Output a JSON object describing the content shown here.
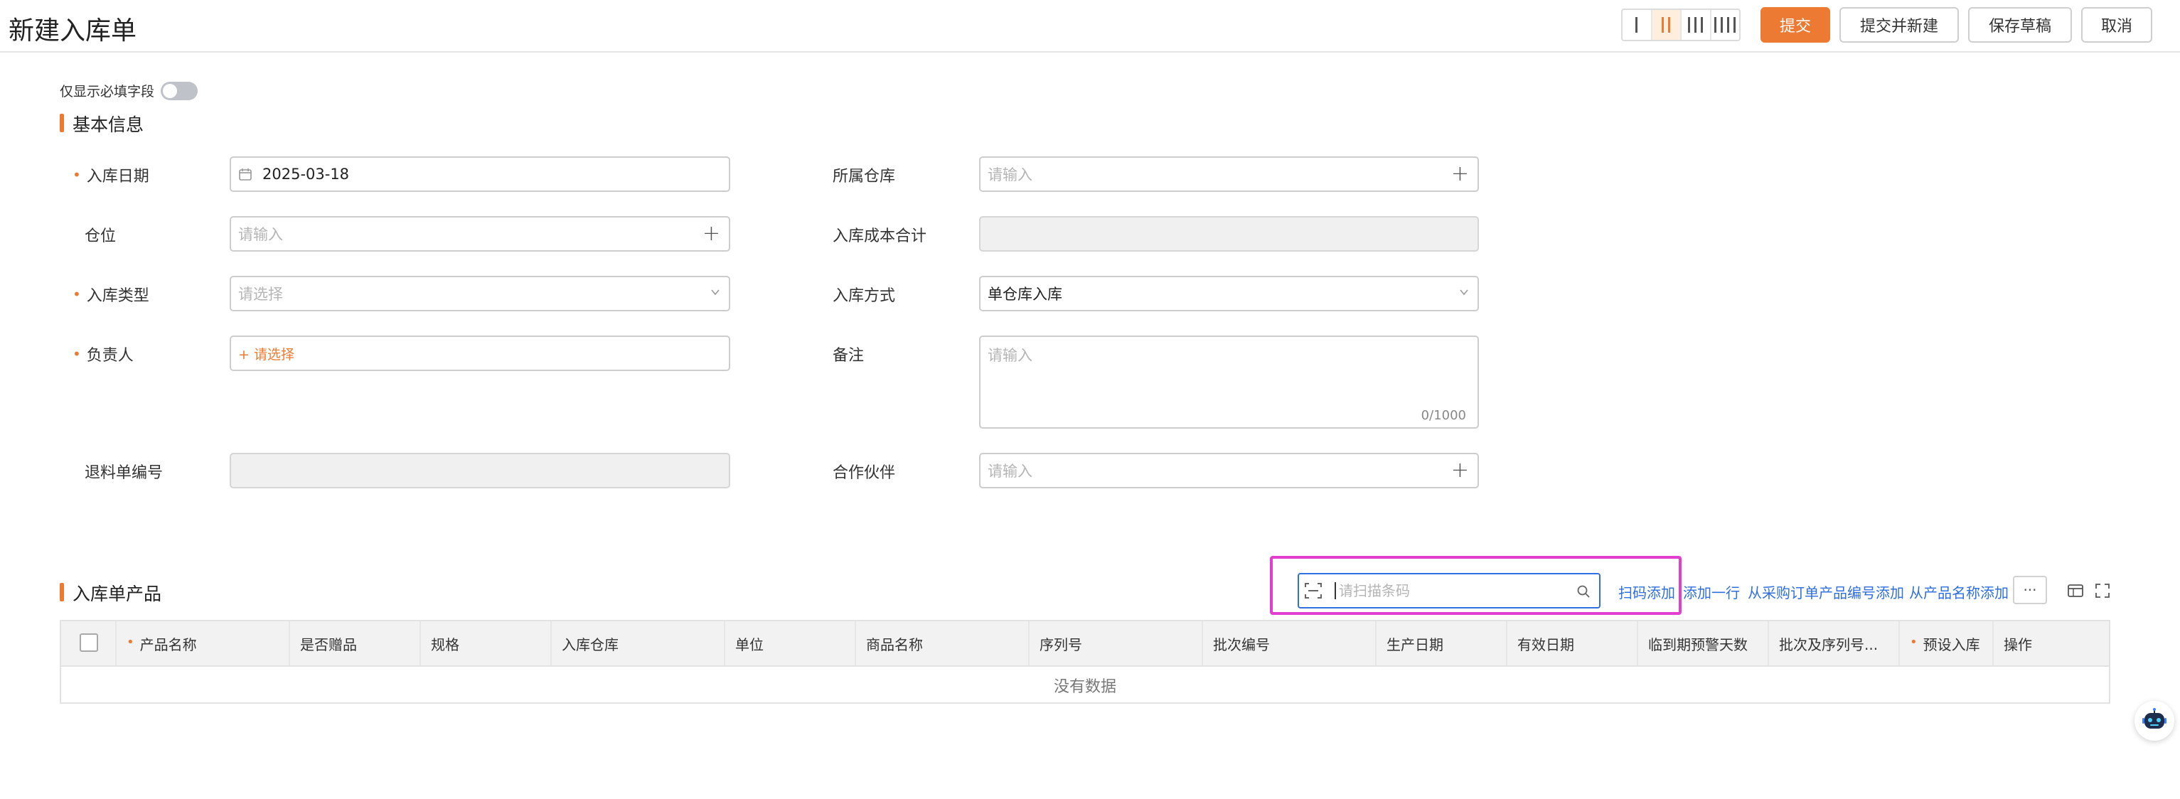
{
  "header": {
    "title": "新建入库单",
    "buttons": {
      "submit": "提交",
      "submit_new": "提交并新建",
      "save_draft": "保存草稿",
      "cancel": "取消"
    }
  },
  "toggle": {
    "label": "仅显示必填字段",
    "on": false
  },
  "basic": {
    "title": "基本信息",
    "fields": {
      "inbound_date": {
        "label": "入库日期",
        "value": "2025-03-18"
      },
      "warehouse": {
        "label": "所属仓库",
        "placeholder": "请输入"
      },
      "location": {
        "label": "仓位",
        "placeholder": "请输入"
      },
      "cost_total": {
        "label": "入库成本合计"
      },
      "inbound_type": {
        "label": "入库类型",
        "placeholder": "请选择"
      },
      "inbound_method": {
        "label": "入库方式",
        "value": "单仓库入库"
      },
      "owner": {
        "label": "负责人",
        "value": "+ 请选择"
      },
      "remark": {
        "label": "备注",
        "placeholder": "请输入",
        "counter": "0/1000"
      },
      "return_no": {
        "label": "退料单编号"
      },
      "partner": {
        "label": "合作伙伴",
        "placeholder": "请输入"
      }
    }
  },
  "products": {
    "title": "入库单产品",
    "scan_placeholder": "请扫描条码",
    "actions": {
      "scan_add": "扫码添加",
      "add_row": "添加一行",
      "from_po": "从采购订单产品编号添加",
      "from_name": "从产品名称添加",
      "more": "···"
    },
    "columns": [
      "产品名称",
      "是否赠品",
      "规格",
      "入库仓库",
      "单位",
      "商品名称",
      "序列号",
      "批次编号",
      "生产日期",
      "有效日期",
      "临到期预警天数",
      "批次及序列号...",
      "预设入库",
      "操作"
    ],
    "empty_text": "没有数据"
  },
  "colors": {
    "accent": "#ed7a33",
    "link": "#2f6fe0",
    "highlight": "#e23fd0"
  }
}
